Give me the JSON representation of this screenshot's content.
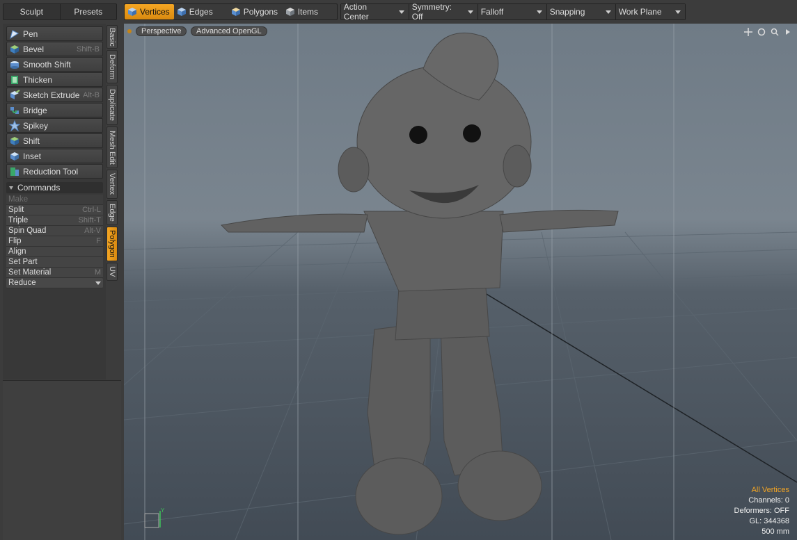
{
  "left_tabs": [
    "Sculpt",
    "Presets"
  ],
  "toolbar": {
    "modes": [
      {
        "label": "Vertices",
        "active": true
      },
      {
        "label": "Edges",
        "active": false
      },
      {
        "label": "Polygons",
        "active": false
      },
      {
        "label": "Items",
        "active": false
      }
    ],
    "dropdowns": [
      "Action Center",
      "Symmetry: Off",
      "Falloff",
      "Snapping",
      "Work Plane"
    ]
  },
  "tools": [
    {
      "label": "Pen",
      "shortcut": "",
      "icon": "pen-icon"
    },
    {
      "label": "Bevel",
      "shortcut": "Shift-B",
      "icon": "bevel-icon"
    },
    {
      "label": "Smooth Shift",
      "shortcut": "",
      "icon": "smooth-shift-icon"
    },
    {
      "label": "Thicken",
      "shortcut": "",
      "icon": "thicken-icon"
    },
    {
      "label": "Sketch Extrude",
      "shortcut": "Alt-B",
      "icon": "sketch-extrude-icon"
    },
    {
      "label": "Bridge",
      "shortcut": "",
      "icon": "bridge-icon"
    },
    {
      "label": "Spikey",
      "shortcut": "",
      "icon": "spikey-icon"
    },
    {
      "label": "Shift",
      "shortcut": "",
      "icon": "shift-icon"
    },
    {
      "label": "Inset",
      "shortcut": "",
      "icon": "inset-icon"
    },
    {
      "label": "Reduction Tool",
      "shortcut": "",
      "icon": "reduction-tool-icon"
    }
  ],
  "commands": {
    "header": "Commands",
    "items": [
      {
        "label": "Make",
        "shortcut": "",
        "disabled": true
      },
      {
        "label": "Split",
        "shortcut": "Ctrl-L"
      },
      {
        "label": "Triple",
        "shortcut": "Shift-T"
      },
      {
        "label": "Spin Quad",
        "shortcut": "Alt-V"
      },
      {
        "label": "Flip",
        "shortcut": "F"
      },
      {
        "label": "Align",
        "shortcut": ""
      },
      {
        "label": "Set Part",
        "shortcut": ""
      },
      {
        "label": "Set Material",
        "shortcut": "M"
      }
    ],
    "dropdown": "Reduce"
  },
  "vertical_tabs": [
    {
      "label": "Basic",
      "active": false
    },
    {
      "label": "Deform",
      "active": false
    },
    {
      "label": "Duplicate",
      "active": false
    },
    {
      "label": "Mesh Edit",
      "active": false
    },
    {
      "label": "Vertex",
      "active": false
    },
    {
      "label": "Edge",
      "active": false
    },
    {
      "label": "Polygon",
      "active": true
    },
    {
      "label": "UV",
      "active": false
    }
  ],
  "viewport": {
    "view": "Perspective",
    "render": "Advanced OpenGL",
    "icons": [
      "move-view-icon",
      "rotate-view-icon",
      "zoom-view-icon",
      "expand-arrow-icon"
    ],
    "info": {
      "selection": "All Vertices",
      "channels": "Channels: 0",
      "deformers": "Deformers: OFF",
      "gl": "GL: 344368",
      "grid": "500 mm"
    },
    "axis_label": "Y"
  },
  "colors": {
    "accent": "#f5a623"
  }
}
